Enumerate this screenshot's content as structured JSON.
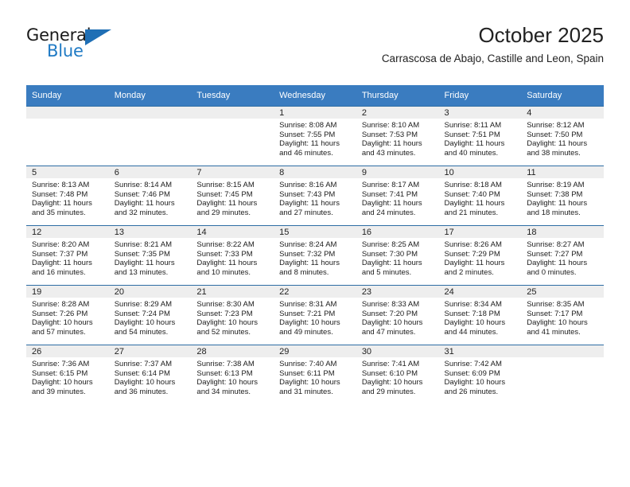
{
  "brand": {
    "name_top": "General",
    "name_bottom": "Blue",
    "triangle_icon": "triangle-icon",
    "accent_color": "#1f7ac4"
  },
  "header": {
    "title": "October 2025",
    "subtitle": "Carrascosa de Abajo, Castille and Leon, Spain"
  },
  "theme": {
    "header_row_color": "#3a7cc0",
    "row_border_color": "#2e6da4",
    "date_band_color": "#eeeeee"
  },
  "weekday_headers": [
    "Sunday",
    "Monday",
    "Tuesday",
    "Wednesday",
    "Thursday",
    "Friday",
    "Saturday"
  ],
  "weeks": [
    [
      {
        "day": "",
        "sunrise": "",
        "sunset": "",
        "daylight_line1": "",
        "daylight_line2": ""
      },
      {
        "day": "",
        "sunrise": "",
        "sunset": "",
        "daylight_line1": "",
        "daylight_line2": ""
      },
      {
        "day": "",
        "sunrise": "",
        "sunset": "",
        "daylight_line1": "",
        "daylight_line2": ""
      },
      {
        "day": "1",
        "sunrise": "Sunrise: 8:08 AM",
        "sunset": "Sunset: 7:55 PM",
        "daylight_line1": "Daylight: 11 hours",
        "daylight_line2": "and 46 minutes."
      },
      {
        "day": "2",
        "sunrise": "Sunrise: 8:10 AM",
        "sunset": "Sunset: 7:53 PM",
        "daylight_line1": "Daylight: 11 hours",
        "daylight_line2": "and 43 minutes."
      },
      {
        "day": "3",
        "sunrise": "Sunrise: 8:11 AM",
        "sunset": "Sunset: 7:51 PM",
        "daylight_line1": "Daylight: 11 hours",
        "daylight_line2": "and 40 minutes."
      },
      {
        "day": "4",
        "sunrise": "Sunrise: 8:12 AM",
        "sunset": "Sunset: 7:50 PM",
        "daylight_line1": "Daylight: 11 hours",
        "daylight_line2": "and 38 minutes."
      }
    ],
    [
      {
        "day": "5",
        "sunrise": "Sunrise: 8:13 AM",
        "sunset": "Sunset: 7:48 PM",
        "daylight_line1": "Daylight: 11 hours",
        "daylight_line2": "and 35 minutes."
      },
      {
        "day": "6",
        "sunrise": "Sunrise: 8:14 AM",
        "sunset": "Sunset: 7:46 PM",
        "daylight_line1": "Daylight: 11 hours",
        "daylight_line2": "and 32 minutes."
      },
      {
        "day": "7",
        "sunrise": "Sunrise: 8:15 AM",
        "sunset": "Sunset: 7:45 PM",
        "daylight_line1": "Daylight: 11 hours",
        "daylight_line2": "and 29 minutes."
      },
      {
        "day": "8",
        "sunrise": "Sunrise: 8:16 AM",
        "sunset": "Sunset: 7:43 PM",
        "daylight_line1": "Daylight: 11 hours",
        "daylight_line2": "and 27 minutes."
      },
      {
        "day": "9",
        "sunrise": "Sunrise: 8:17 AM",
        "sunset": "Sunset: 7:41 PM",
        "daylight_line1": "Daylight: 11 hours",
        "daylight_line2": "and 24 minutes."
      },
      {
        "day": "10",
        "sunrise": "Sunrise: 8:18 AM",
        "sunset": "Sunset: 7:40 PM",
        "daylight_line1": "Daylight: 11 hours",
        "daylight_line2": "and 21 minutes."
      },
      {
        "day": "11",
        "sunrise": "Sunrise: 8:19 AM",
        "sunset": "Sunset: 7:38 PM",
        "daylight_line1": "Daylight: 11 hours",
        "daylight_line2": "and 18 minutes."
      }
    ],
    [
      {
        "day": "12",
        "sunrise": "Sunrise: 8:20 AM",
        "sunset": "Sunset: 7:37 PM",
        "daylight_line1": "Daylight: 11 hours",
        "daylight_line2": "and 16 minutes."
      },
      {
        "day": "13",
        "sunrise": "Sunrise: 8:21 AM",
        "sunset": "Sunset: 7:35 PM",
        "daylight_line1": "Daylight: 11 hours",
        "daylight_line2": "and 13 minutes."
      },
      {
        "day": "14",
        "sunrise": "Sunrise: 8:22 AM",
        "sunset": "Sunset: 7:33 PM",
        "daylight_line1": "Daylight: 11 hours",
        "daylight_line2": "and 10 minutes."
      },
      {
        "day": "15",
        "sunrise": "Sunrise: 8:24 AM",
        "sunset": "Sunset: 7:32 PM",
        "daylight_line1": "Daylight: 11 hours",
        "daylight_line2": "and 8 minutes."
      },
      {
        "day": "16",
        "sunrise": "Sunrise: 8:25 AM",
        "sunset": "Sunset: 7:30 PM",
        "daylight_line1": "Daylight: 11 hours",
        "daylight_line2": "and 5 minutes."
      },
      {
        "day": "17",
        "sunrise": "Sunrise: 8:26 AM",
        "sunset": "Sunset: 7:29 PM",
        "daylight_line1": "Daylight: 11 hours",
        "daylight_line2": "and 2 minutes."
      },
      {
        "day": "18",
        "sunrise": "Sunrise: 8:27 AM",
        "sunset": "Sunset: 7:27 PM",
        "daylight_line1": "Daylight: 11 hours",
        "daylight_line2": "and 0 minutes."
      }
    ],
    [
      {
        "day": "19",
        "sunrise": "Sunrise: 8:28 AM",
        "sunset": "Sunset: 7:26 PM",
        "daylight_line1": "Daylight: 10 hours",
        "daylight_line2": "and 57 minutes."
      },
      {
        "day": "20",
        "sunrise": "Sunrise: 8:29 AM",
        "sunset": "Sunset: 7:24 PM",
        "daylight_line1": "Daylight: 10 hours",
        "daylight_line2": "and 54 minutes."
      },
      {
        "day": "21",
        "sunrise": "Sunrise: 8:30 AM",
        "sunset": "Sunset: 7:23 PM",
        "daylight_line1": "Daylight: 10 hours",
        "daylight_line2": "and 52 minutes."
      },
      {
        "day": "22",
        "sunrise": "Sunrise: 8:31 AM",
        "sunset": "Sunset: 7:21 PM",
        "daylight_line1": "Daylight: 10 hours",
        "daylight_line2": "and 49 minutes."
      },
      {
        "day": "23",
        "sunrise": "Sunrise: 8:33 AM",
        "sunset": "Sunset: 7:20 PM",
        "daylight_line1": "Daylight: 10 hours",
        "daylight_line2": "and 47 minutes."
      },
      {
        "day": "24",
        "sunrise": "Sunrise: 8:34 AM",
        "sunset": "Sunset: 7:18 PM",
        "daylight_line1": "Daylight: 10 hours",
        "daylight_line2": "and 44 minutes."
      },
      {
        "day": "25",
        "sunrise": "Sunrise: 8:35 AM",
        "sunset": "Sunset: 7:17 PM",
        "daylight_line1": "Daylight: 10 hours",
        "daylight_line2": "and 41 minutes."
      }
    ],
    [
      {
        "day": "26",
        "sunrise": "Sunrise: 7:36 AM",
        "sunset": "Sunset: 6:15 PM",
        "daylight_line1": "Daylight: 10 hours",
        "daylight_line2": "and 39 minutes."
      },
      {
        "day": "27",
        "sunrise": "Sunrise: 7:37 AM",
        "sunset": "Sunset: 6:14 PM",
        "daylight_line1": "Daylight: 10 hours",
        "daylight_line2": "and 36 minutes."
      },
      {
        "day": "28",
        "sunrise": "Sunrise: 7:38 AM",
        "sunset": "Sunset: 6:13 PM",
        "daylight_line1": "Daylight: 10 hours",
        "daylight_line2": "and 34 minutes."
      },
      {
        "day": "29",
        "sunrise": "Sunrise: 7:40 AM",
        "sunset": "Sunset: 6:11 PM",
        "daylight_line1": "Daylight: 10 hours",
        "daylight_line2": "and 31 minutes."
      },
      {
        "day": "30",
        "sunrise": "Sunrise: 7:41 AM",
        "sunset": "Sunset: 6:10 PM",
        "daylight_line1": "Daylight: 10 hours",
        "daylight_line2": "and 29 minutes."
      },
      {
        "day": "31",
        "sunrise": "Sunrise: 7:42 AM",
        "sunset": "Sunset: 6:09 PM",
        "daylight_line1": "Daylight: 10 hours",
        "daylight_line2": "and 26 minutes."
      },
      {
        "day": "",
        "sunrise": "",
        "sunset": "",
        "daylight_line1": "",
        "daylight_line2": ""
      }
    ]
  ]
}
